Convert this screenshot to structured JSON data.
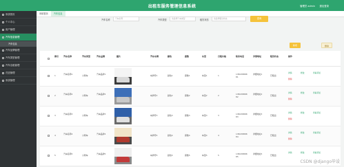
{
  "header": {
    "title": "出租车服务管理信息系统",
    "user_text": "管理员 admin",
    "logout_label": "退出登录"
  },
  "sidebar": {
    "items": [
      {
        "label": "系统首页"
      },
      {
        "label": "个人中心"
      },
      {
        "label": "用户管理"
      },
      {
        "label": "汽车信息管理"
      },
      {
        "label": "汽车品牌管理"
      },
      {
        "label": "汽车类型管理"
      },
      {
        "label": "汽车出租管理"
      },
      {
        "label": "归还管理"
      },
      {
        "label": "系统管理"
      }
    ],
    "submenu_label": "汽车信息"
  },
  "tabs": [
    {
      "label": "系统首页"
    },
    {
      "label": "汽车信息"
    }
  ],
  "search": {
    "fields": [
      {
        "label": "汽车名称",
        "placeholder": "汽车名称"
      },
      {
        "label": "汽车类型",
        "placeholder": "请选择汽车类型"
      },
      {
        "label": "租赁状态",
        "placeholder": "请选择租赁状态"
      }
    ],
    "query_label": "查询"
  },
  "actions": {
    "add_label": "新增",
    "delete_label": "删除"
  },
  "table": {
    "headers": [
      "索引",
      "汽车名称",
      "汽车类型",
      "汽车品牌",
      "图片",
      "汽车车牌",
      "颜色",
      "座数",
      "车型",
      "日租价格",
      "联系电话",
      "详细地址",
      "租赁状态",
      "操作"
    ],
    "rows": [
      {
        "index": "1",
        "name": "汽车名称1",
        "type": "小轿车",
        "brand": "汽车品牌1",
        "plate": "车牌号1",
        "color": "颜色1",
        "seats": "座数1",
        "model": "车型1",
        "price": "1",
        "phone": "13823888881",
        "address": "详细地址1",
        "status": "已租出"
      },
      {
        "index": "2",
        "name": "汽车名称2",
        "type": "小轿车",
        "brand": "汽车品牌2",
        "plate": "车牌号2",
        "color": "颜色2",
        "seats": "座数2",
        "model": "车型2",
        "price": "2",
        "phone": "13823888882",
        "address": "详细地址2",
        "status": "已租出"
      },
      {
        "index": "3",
        "name": "汽车名称3",
        "type": "小轿车",
        "brand": "汽车品牌3",
        "plate": "车牌号3",
        "color": "颜色3",
        "seats": "座数3",
        "model": "车型3",
        "price": "3",
        "phone": "13823888883",
        "address": "详细地址3",
        "status": "已租出"
      },
      {
        "index": "4",
        "name": "汽车名称4",
        "type": "小轿车",
        "brand": "汽车品牌4",
        "plate": "车牌号4",
        "color": "颜色4",
        "seats": "座数4",
        "model": "车型4",
        "price": "4",
        "phone": "13823888884",
        "address": "详细地址4",
        "status": "已租出"
      },
      {
        "index": "5",
        "name": "汽车名称5",
        "type": "小轿车",
        "brand": "汽车品牌5",
        "plate": "车牌号5",
        "color": "颜色5",
        "seats": "座数5",
        "model": "车型5",
        "price": "5",
        "phone": "13823888885",
        "address": "详细地址5",
        "status": "已租出"
      }
    ],
    "row_actions": {
      "detail": "详情",
      "edit": "修改",
      "review": "查看评论",
      "delete": "删除"
    }
  },
  "watermark": "CSDN @django毕设",
  "colors": {
    "accent": "#2ea56f",
    "sidebar": "#2f3335",
    "query": "#f5c23a",
    "danger": "#e04a4a"
  }
}
